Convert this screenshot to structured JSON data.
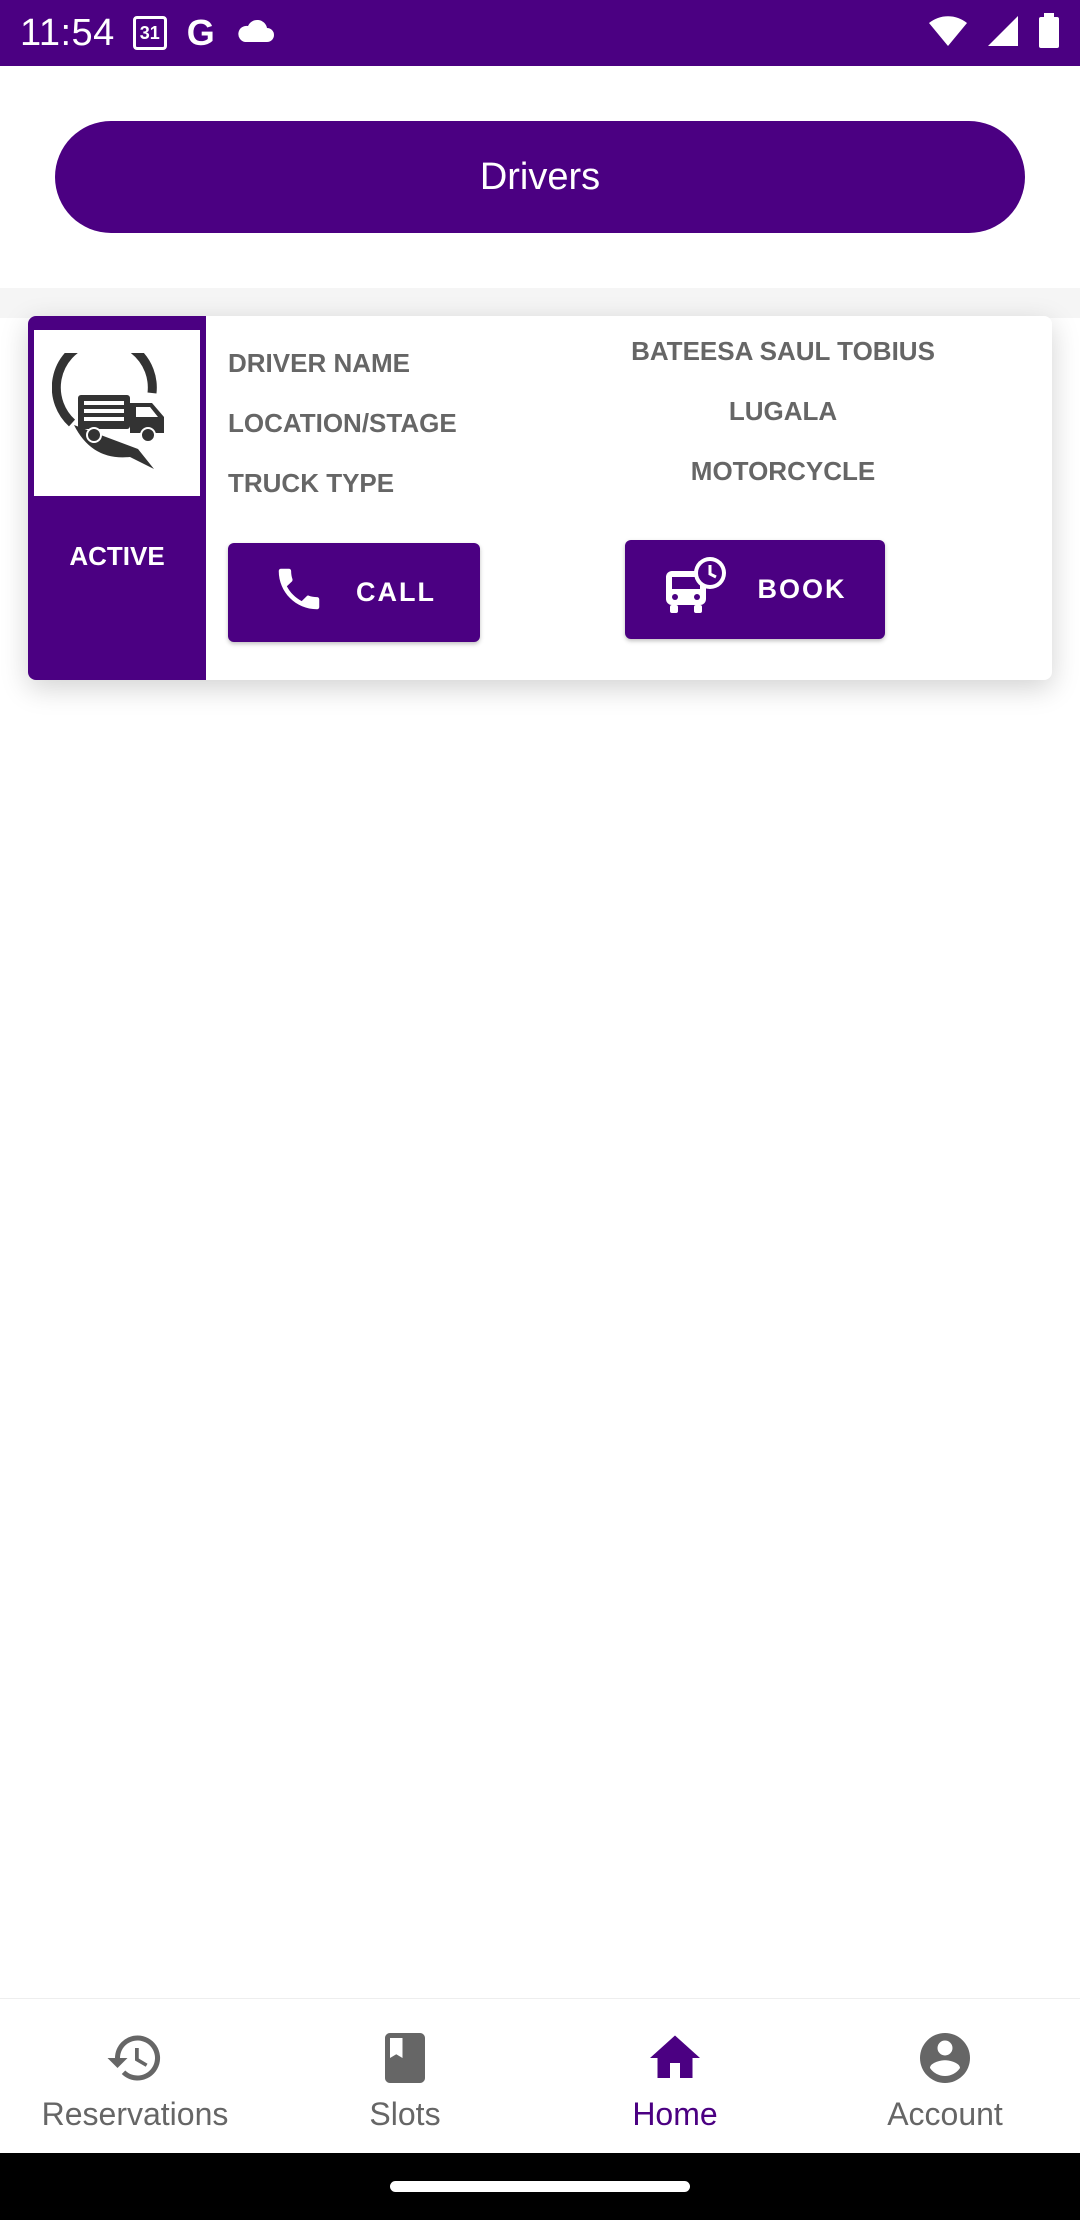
{
  "status_bar": {
    "time": "11:54",
    "calendar_day": "31",
    "google_letter": "G"
  },
  "header": {
    "drivers_label": "Drivers"
  },
  "driver_card": {
    "status": "ACTIVE",
    "labels": {
      "driver_name": "DRIVER NAME",
      "location": "LOCATION/STAGE",
      "truck_type": "TRUCK TYPE"
    },
    "values": {
      "driver_name": "BATEESA SAUL TOBIUS",
      "location": "LUGALA",
      "truck_type": "MOTORCYCLE"
    },
    "call_label": "CALL",
    "book_label": "BOOK"
  },
  "bottom_nav": {
    "items": [
      {
        "label": "Reservations",
        "icon": "history-icon"
      },
      {
        "label": "Slots",
        "icon": "book-icon"
      },
      {
        "label": "Home",
        "icon": "home-icon"
      },
      {
        "label": "Account",
        "icon": "account-icon"
      }
    ],
    "active": "Home"
  },
  "colors": {
    "primary": "#4b0082",
    "text_gray": "#666666",
    "background": "#ffffff"
  }
}
